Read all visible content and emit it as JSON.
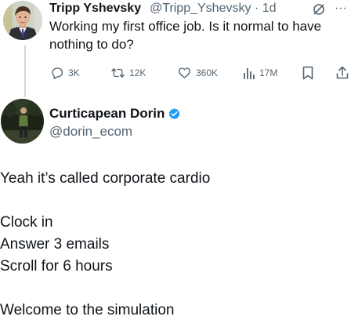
{
  "original_tweet": {
    "author_name": "Tripp Yshevsky",
    "handle_time": "@Tripp_Yshevsky · 1d",
    "text_lines": [
      "Working my first office job. Is it normal to have",
      "nothing to do?"
    ],
    "replies": "3K",
    "reposts": "12K",
    "likes": "360K",
    "views": "17M",
    "more": "···"
  },
  "reply_tweet": {
    "author_name": "Curticapean Dorin",
    "handle": "@dorin_ecom",
    "lines": [
      "Yeah it’s called corporate cardio",
      "",
      "Clock in",
      "Answer 3 emails",
      "Scroll for 6 hours",
      "",
      "Welcome to the simulation"
    ]
  },
  "colors": {
    "text": "#0f1419",
    "secondary": "#536471",
    "verified": "#1d9bf0",
    "thread_line": "#cfd9de"
  },
  "icons": [
    "reply-icon",
    "repost-icon",
    "like-icon",
    "views-icon",
    "bookmark-icon",
    "share-icon",
    "grok-icon",
    "verified-badge-icon"
  ]
}
